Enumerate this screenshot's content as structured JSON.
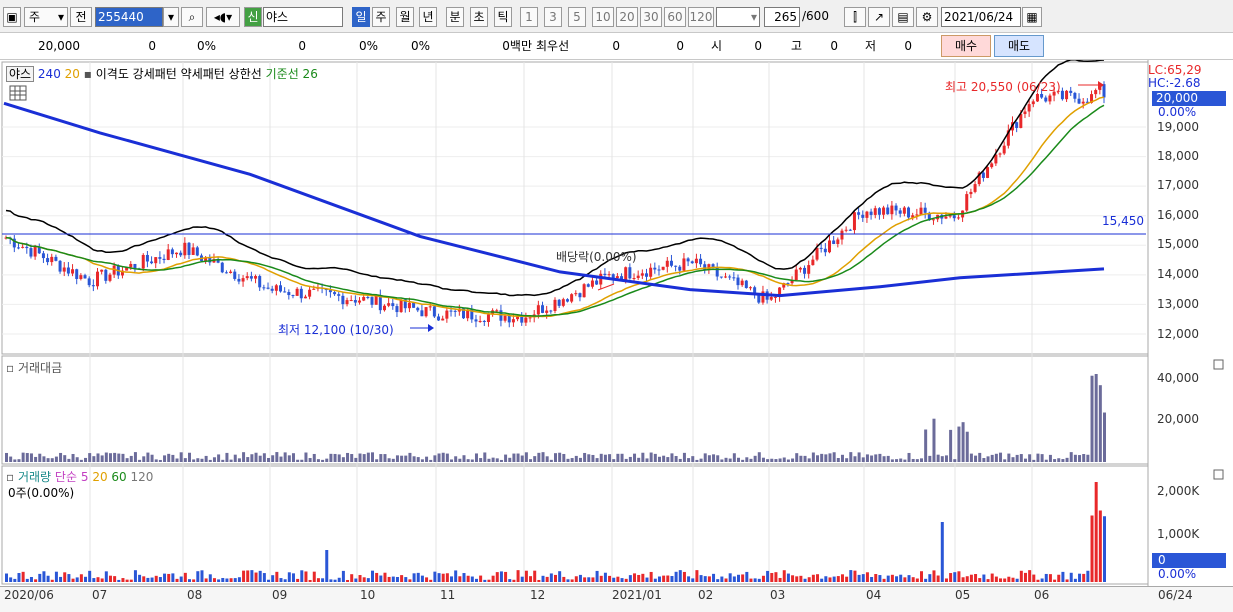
{
  "toolbar": {
    "market": "주",
    "prev": "전",
    "code": "255440",
    "credit": "신",
    "name": "야스",
    "periods": [
      "일",
      "주",
      "월",
      "년",
      "분",
      "초",
      "틱"
    ],
    "ranges": [
      "1",
      "3",
      "5",
      "10",
      "20",
      "30",
      "60",
      "120"
    ],
    "count": "265",
    "count_total": "/600",
    "date": "2021/06/24"
  },
  "quote": {
    "price": "20,000",
    "change": "0",
    "rate": "0%",
    "volume": "0",
    "vol_rate": "0%",
    "rate2": "0%",
    "amount": "0백만",
    "best_label": "최우선",
    "best_val1": "0",
    "best_val2": "0",
    "open_label": "시",
    "open_val": "0",
    "high_label": "고",
    "high_val": "0",
    "low_label": "저",
    "low_val": "0",
    "buy": "매수",
    "sell": "매도"
  },
  "price_panel": {
    "legend": {
      "name": "야스",
      "ma240": "240",
      "ma20": "20",
      "envelope": "이격도 강세패턴",
      "weak": "약세패턴",
      "upper": "상한선",
      "base": "기준선 26"
    },
    "lc": "LC:65,29",
    "hc": "HC:-2.68",
    "current_tag": "20,000",
    "current_pct": "0.00%",
    "high_note": "최고 20,550 (06/23)",
    "low_note": "최저 12,100 (10/30)",
    "dividend_note": "배당락(0.00%)",
    "hline_label": "15,450",
    "yticks": [
      "19,000",
      "18,000",
      "17,000",
      "16,000",
      "15,000",
      "14,000",
      "13,000",
      "12,000"
    ]
  },
  "amount_panel": {
    "legend": "거래대금",
    "yticks": [
      "40,000",
      "20,000"
    ]
  },
  "volume_panel": {
    "legend": "거래량",
    "ma_label": "단순",
    "ma5": "5",
    "ma20": "20",
    "ma60": "60",
    "ma120": "120",
    "sub": "0주(0.00%)",
    "yticks": [
      "2,000K",
      "1,000K"
    ],
    "current_tag": "0",
    "current_pct": "0.00%"
  },
  "xaxis": [
    "2020/06",
    "07",
    "08",
    "09",
    "10",
    "11",
    "12",
    "2021/01",
    "02",
    "03",
    "04",
    "05",
    "06",
    "06/24"
  ],
  "colors": {
    "up": "#e8282a",
    "down": "#2a56d6",
    "ma240": "#1a2fd6",
    "ma20": "#e0a000",
    "base": "#1a8a1a",
    "env": "#000000"
  },
  "chart_data": {
    "type": "candlestick",
    "title": "야스",
    "x_range": [
      "2020/06",
      "2021/06/24"
    ],
    "y_range": [
      11500,
      21000
    ],
    "high": {
      "value": 20550,
      "date": "06/23"
    },
    "low": {
      "value": 12100,
      "date": "10/30"
    },
    "last": 20000,
    "hline": 15450,
    "monthly_close": [
      {
        "m": "2020/06",
        "v": 15300
      },
      {
        "m": "07",
        "v": 13800
      },
      {
        "m": "08",
        "v": 14900
      },
      {
        "m": "09",
        "v": 13500
      },
      {
        "m": "10",
        "v": 13200
      },
      {
        "m": "11",
        "v": 12700
      },
      {
        "m": "12",
        "v": 12600
      },
      {
        "m": "2021/01",
        "v": 14000
      },
      {
        "m": "02",
        "v": 14400
      },
      {
        "m": "03",
        "v": 13100
      },
      {
        "m": "04",
        "v": 16200
      },
      {
        "m": "05",
        "v": 16000
      },
      {
        "m": "06",
        "v": 20000
      }
    ]
  }
}
